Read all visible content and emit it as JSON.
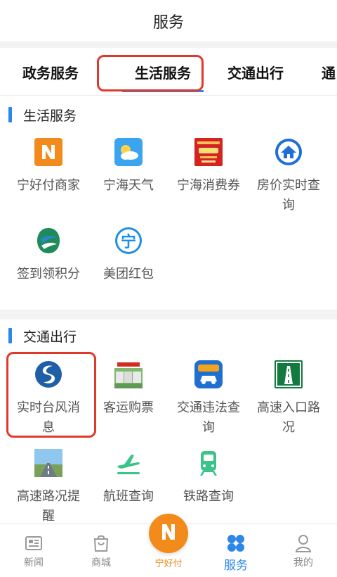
{
  "header": {
    "title": "服务"
  },
  "tabs": [
    {
      "label": "政务服务"
    },
    {
      "label": "生活服务"
    },
    {
      "label": "交通出行"
    },
    {
      "label": "通"
    }
  ],
  "sections": [
    {
      "title": "生活服务",
      "items": [
        {
          "label": "宁好付商家",
          "icon": "ninghaofu-merchant-icon"
        },
        {
          "label": "宁海天气",
          "icon": "weather-icon"
        },
        {
          "label": "宁海消费券",
          "icon": "consumption-coupon-icon"
        },
        {
          "label": "房价实时查询",
          "icon": "house-price-icon"
        },
        {
          "label": "签到领积分",
          "icon": "checkin-points-icon"
        },
        {
          "label": "美团红包",
          "icon": "meituan-redpacket-icon"
        }
      ]
    },
    {
      "title": "交通出行",
      "items": [
        {
          "label": "实时台风消息",
          "icon": "typhoon-icon"
        },
        {
          "label": "客运购票",
          "icon": "bus-ticket-icon"
        },
        {
          "label": "交通违法查询",
          "icon": "traffic-violation-icon"
        },
        {
          "label": "高速入口路况",
          "icon": "highway-entrance-icon"
        },
        {
          "label": "高速路况提醒",
          "icon": "highway-traffic-icon"
        },
        {
          "label": "航班查询",
          "icon": "flight-icon"
        },
        {
          "label": "铁路查询",
          "icon": "railway-icon"
        }
      ]
    }
  ],
  "bottom_nav": [
    {
      "label": "新闻",
      "icon": "news-icon"
    },
    {
      "label": "商城",
      "icon": "shop-bag-icon"
    },
    {
      "label": "宁好付",
      "icon": "ninghaofu-logo-icon"
    },
    {
      "label": "服务",
      "icon": "service-clover-icon"
    },
    {
      "label": "我的",
      "icon": "profile-icon"
    }
  ],
  "colors": {
    "accent": "#2b87e8",
    "highlight": "#e0392c",
    "brand_orange": "#f28b1b"
  }
}
